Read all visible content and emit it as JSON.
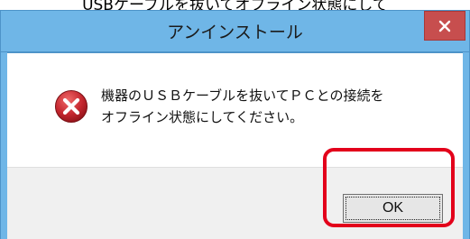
{
  "context_text": "USBケーブルを抜いてオフライン状態にして",
  "dialog": {
    "title": "アンインストール",
    "close_icon": "close-icon",
    "icon": "error-icon",
    "message_line1": "機器のＵＳＢケーブルを抜いてＰＣとの接続を",
    "message_line2": "オフライン状態にしてください。",
    "ok_label": "OK"
  },
  "colors": {
    "titlebar": "#6fb6e7",
    "close_button": "#c74e4e",
    "error_icon": "#c4262e",
    "highlight": "#e3001b",
    "button_area": "#f0f0f0"
  }
}
